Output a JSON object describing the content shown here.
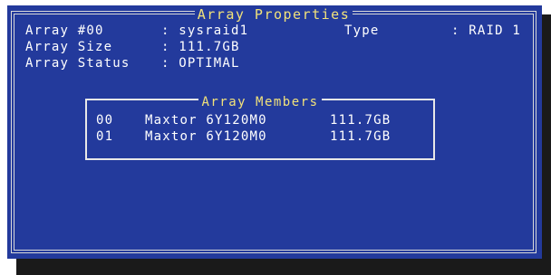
{
  "window": {
    "title": "Array Properties"
  },
  "properties": {
    "array_label": "Array #00",
    "array_value": ": sysraid1",
    "type_label": "Type",
    "type_value": ": RAID 1",
    "size_label": "Array Size",
    "size_value": ": 111.7GB",
    "status_label": "Array Status",
    "status_value": ": OPTIMAL"
  },
  "members": {
    "title": "Array Members",
    "rows": [
      {
        "index": "00",
        "model": "Maxtor 6Y120M0",
        "size": "111.7GB"
      },
      {
        "index": "01",
        "model": "Maxtor 6Y120M0",
        "size": "111.7GB"
      }
    ]
  },
  "colors": {
    "background": "#233a9c",
    "title_text": "#f2e27a",
    "body_text": "#ffffff",
    "border": "#d9d9d9",
    "shadow": "#1a1a1a"
  }
}
